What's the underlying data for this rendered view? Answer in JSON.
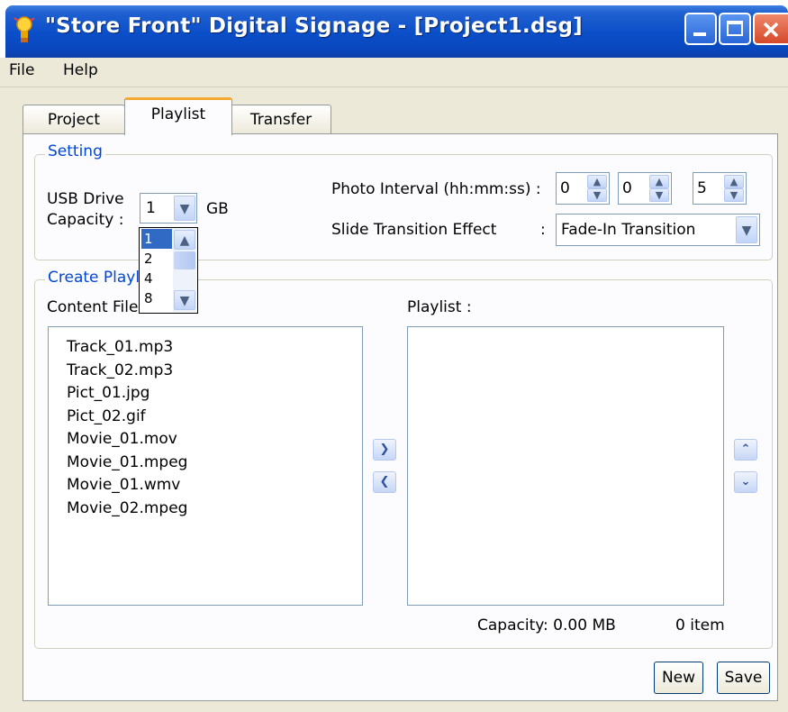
{
  "window": {
    "title": "\"Store Front\" Digital Signage - [Project1.dsg]"
  },
  "menu": {
    "items": [
      "File",
      "Help"
    ]
  },
  "tabs": [
    {
      "label": "Project",
      "selected": false
    },
    {
      "label": "Playlist",
      "selected": true
    },
    {
      "label": "Transfer",
      "selected": false
    }
  ],
  "setting": {
    "legend": "Setting",
    "usb_label_line1": "USB Drive",
    "usb_label_line2": "Capacity  :",
    "usb_value": "1",
    "usb_unit": "GB",
    "usb_options": [
      "1",
      "2",
      "4",
      "8"
    ],
    "photo_interval_label": "Photo Interval (hh:mm:ss) :",
    "interval_hh": "0",
    "interval_mm": "0",
    "interval_ss": "5",
    "transition_label": "Slide Transition Effect",
    "transition_colon": ":",
    "transition_value": "Fade-In Transition"
  },
  "create": {
    "legend": "Create Playlist",
    "content_label": "Content File(s) :",
    "content_files": [
      "Track_01.mp3",
      "Track_02.mp3",
      "Pict_01.jpg",
      "Pict_02.gif",
      "Movie_01.mov",
      "Movie_01.mpeg",
      "Movie_01.wmv",
      "Movie_02.mpeg"
    ],
    "playlist_label": "Playlist :",
    "capacity_text": "Capacity: 0.00 MB",
    "item_count_text": "0 item"
  },
  "buttons": {
    "new_label": "New",
    "save_label": "Save"
  },
  "colors": {
    "titlebar": "#0a4ec8",
    "legend_text": "#0046d5",
    "selected_option": "#316ac5",
    "dialog_bg": "#ece9d8"
  }
}
